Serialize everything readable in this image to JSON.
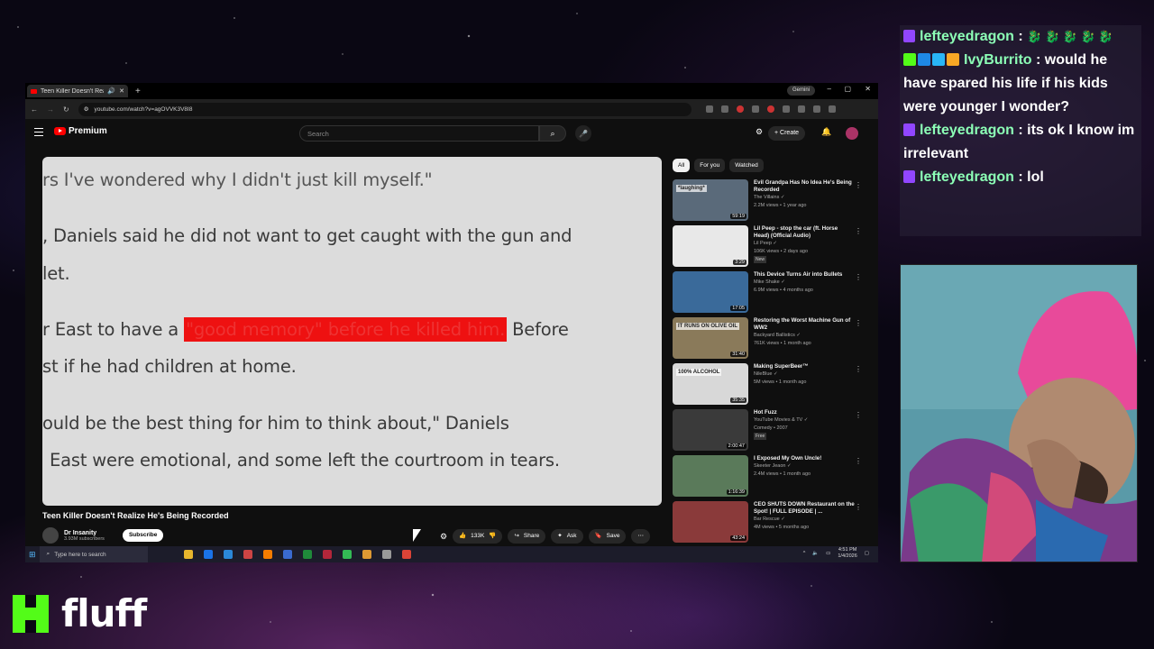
{
  "browser": {
    "tab_title": "Teen Killer Doesn't Realiz",
    "url": "youtube.com/watch?v=agOVVK3V8I8",
    "gemini_label": "Gemini"
  },
  "youtube": {
    "logo_label": "Premium",
    "search_placeholder": "Search",
    "create_label": "Create"
  },
  "video": {
    "lines": [
      "rs I've wondered why I didn't just kill myself.\"",
      ", Daniels said he did not want to get caught with the gun and",
      "let.",
      "r East to have a",
      "\"good memory\" before he killed him.",
      "Before",
      "st if he had children at home.",
      "ould be the best thing for him to think about,\" Daniels",
      "East were emotional, and some left the courtroom in tears."
    ],
    "title": "Teen Killer Doesn't Realize He's Being Recorded",
    "channel": "Dr Insanity",
    "subscribers": "3.93M subscribers",
    "subscribe_label": "Subscribe",
    "likes": "133K",
    "share_label": "Share",
    "ask_label": "Ask",
    "save_label": "Save"
  },
  "filters": [
    "All",
    "For you",
    "Watched"
  ],
  "recommendations": [
    {
      "title": "Evil Grandpa Has No Idea He's Being Recorded",
      "channel": "The Villains",
      "meta": "2.2M views • 1 year ago",
      "duration": "59:19",
      "color": "#5a6a7a",
      "thumb_text": "*laughing*"
    },
    {
      "title": "Lil Peep - stop the car (ft. Horse Head) (Official Audio)",
      "channel": "Lil Peep",
      "meta": "106K views • 2 days ago",
      "duration": "3:29",
      "color": "#e8e8e8",
      "badge": "New"
    },
    {
      "title": "This Device Turns Air into Bullets",
      "channel": "Mike Shake",
      "meta": "6.9M views • 4 months ago",
      "duration": "17:05",
      "color": "#3a6a9a"
    },
    {
      "title": "Restoring the Worst Machine Gun of WW2",
      "channel": "Backyard Ballistics",
      "meta": "761K views • 1 month ago",
      "duration": "31:40",
      "color": "#8a7a5a",
      "thumb_text": "IT RUNS ON OLIVE OIL"
    },
    {
      "title": "Making SuperBeer™",
      "channel": "NileBlue",
      "meta": "5M views • 1 month ago",
      "duration": "35:35",
      "color": "#d8d8d8",
      "thumb_text": "100% ALCOHOL"
    },
    {
      "title": "Hot Fuzz",
      "channel": "YouTube Movies & TV",
      "meta": "Comedy • 2007",
      "duration": "2:00:47",
      "color": "#3a3a3a",
      "badge": "Free"
    },
    {
      "title": "I Exposed My Own Uncle!",
      "channel": "Skeeter Jeaon",
      "meta": "2.4M views • 1 month ago",
      "duration": "1:16:39",
      "color": "#5a7a5a"
    },
    {
      "title": "CEO SHUTS DOWN Restaurant on the Spot! | FULL EPISODE | ...",
      "channel": "Bar Rescue",
      "meta": "4M views • 5 months ago",
      "duration": "43:24",
      "color": "#8a3a3a"
    }
  ],
  "taskbar": {
    "search_placeholder": "Type here to search",
    "time": "4:51 PM",
    "date": "1/4/2026"
  },
  "chat": [
    {
      "user": "lefteyedragon",
      "text": " : ",
      "emotes": "🐉 🐉 🐉 🐉 🐉"
    },
    {
      "user": "IvyBurrito",
      "text": " : would he have spared his life if his kids were younger I wonder?"
    },
    {
      "user": "lefteyedragon",
      "text": " : its ok I know im irrelevant"
    },
    {
      "user": "lefteyedragon",
      "text": " : lol"
    }
  ],
  "stream": {
    "brand": "fluff"
  }
}
